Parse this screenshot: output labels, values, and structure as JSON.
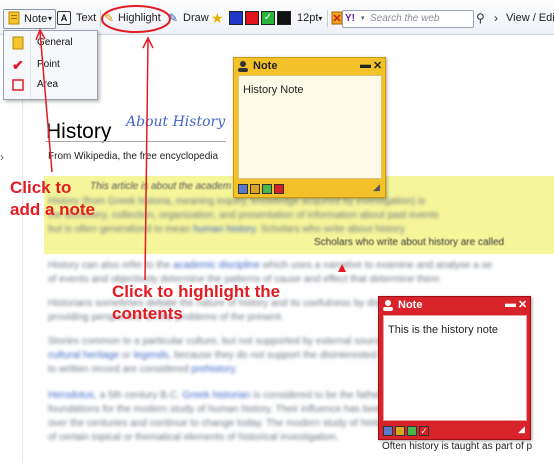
{
  "toolbar": {
    "note_label": "Note",
    "text_label": "Text",
    "highlight_label": "Highlight",
    "draw_label": "Draw",
    "font_size": "12pt",
    "search_placeholder": "Search the web",
    "view_edit_label": "View / Edi",
    "colors": [
      "#1f36c9",
      "#e0121b",
      "#27b53b",
      "#111111"
    ],
    "icons": [
      "note-icon",
      "text-icon",
      "highlight-pen-icon",
      "draw-pen-icon",
      "star-icon",
      "settings-icon",
      "yahoo-icon",
      "search-icon"
    ]
  },
  "note_menu": {
    "items": [
      {
        "label": "General",
        "icon": "general-note-icon"
      },
      {
        "label": "Point",
        "icon": "point-check-icon"
      },
      {
        "label": "Area",
        "icon": "area-rect-icon"
      }
    ]
  },
  "article": {
    "about_label": "About History",
    "title": "History",
    "subtitle": "From Wikipedia, the free encyclopedia",
    "hatnote": "This article is about the academ",
    "line_fragment_1": "Scholars who write about history are called",
    "line_fragment_2": "Often history is taught as part of p"
  },
  "note_yellow": {
    "title": "Note",
    "body": "History Note",
    "colors": [
      "#5b79c9",
      "#d9a623",
      "#47b64b",
      "#d52224"
    ]
  },
  "note_red": {
    "title": "Note",
    "body": "This is the history note",
    "colors": [
      "#5b79c9",
      "#d9a623",
      "#47b64b",
      "#d52224"
    ]
  },
  "annotations": {
    "add_note": [
      "Click to",
      "add a note"
    ],
    "highlight": [
      "Click to highlight the",
      "contents"
    ]
  },
  "accent": "#e31b23"
}
